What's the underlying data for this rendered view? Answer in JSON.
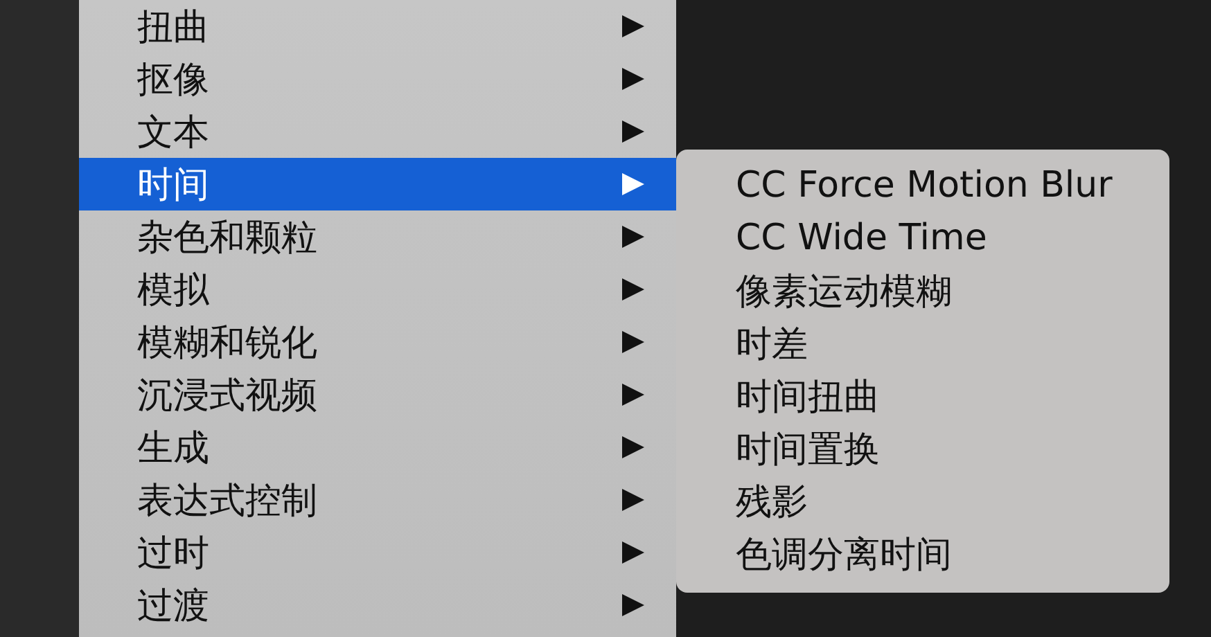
{
  "menu": {
    "items": [
      {
        "label": "扭曲",
        "selected": false,
        "has_submenu": true
      },
      {
        "label": "抠像",
        "selected": false,
        "has_submenu": true
      },
      {
        "label": "文本",
        "selected": false,
        "has_submenu": true
      },
      {
        "label": "时间",
        "selected": true,
        "has_submenu": true
      },
      {
        "label": "杂色和颗粒",
        "selected": false,
        "has_submenu": true
      },
      {
        "label": "模拟",
        "selected": false,
        "has_submenu": true
      },
      {
        "label": "模糊和锐化",
        "selected": false,
        "has_submenu": true
      },
      {
        "label": "沉浸式视频",
        "selected": false,
        "has_submenu": true
      },
      {
        "label": "生成",
        "selected": false,
        "has_submenu": true
      },
      {
        "label": "表达式控制",
        "selected": false,
        "has_submenu": true
      },
      {
        "label": "过时",
        "selected": false,
        "has_submenu": true
      },
      {
        "label": "过渡",
        "selected": false,
        "has_submenu": true
      }
    ]
  },
  "submenu": {
    "items": [
      {
        "label": "CC Force Motion Blur"
      },
      {
        "label": "CC Wide Time"
      },
      {
        "label": "像素运动模糊"
      },
      {
        "label": "时差"
      },
      {
        "label": "时间扭曲"
      },
      {
        "label": "时间置换"
      },
      {
        "label": "残影"
      },
      {
        "label": "色调分离时间"
      }
    ]
  }
}
